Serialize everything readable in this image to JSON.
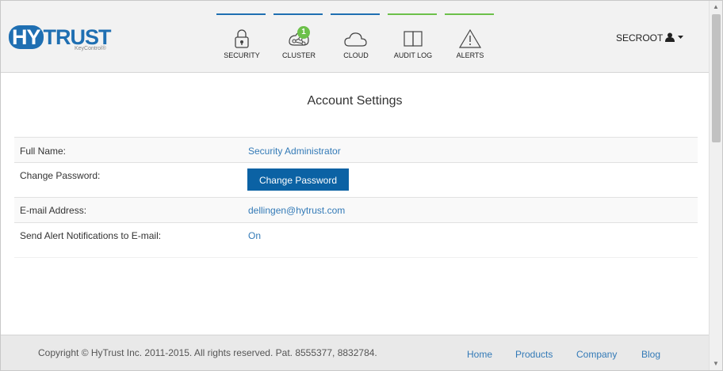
{
  "logo": {
    "hy": "HY",
    "trust": "TRUST",
    "sub": "KeyControl®"
  },
  "nav": {
    "items": [
      {
        "label": "SECURITY",
        "icon": "lock-icon",
        "bar_color": "#1f6fb2"
      },
      {
        "label": "CLUSTER",
        "icon": "cluster-icon",
        "bar_color": "#1f6fb2",
        "badge": "1"
      },
      {
        "label": "CLOUD",
        "icon": "cloud-icon",
        "bar_color": "#1f6fb2"
      },
      {
        "label": "AUDIT LOG",
        "icon": "book-icon",
        "bar_color": "#6cc04a"
      },
      {
        "label": "ALERTS",
        "icon": "warning-icon",
        "bar_color": "#6cc04a"
      }
    ]
  },
  "user": {
    "name": "SECROOT",
    "icon": "user-icon"
  },
  "page": {
    "title": "Account Settings"
  },
  "settings": {
    "full_name": {
      "label": "Full Name:",
      "value": "Security Administrator"
    },
    "password": {
      "label": "Change Password:",
      "button": "Change Password"
    },
    "email": {
      "label": "E-mail Address:",
      "value": "dellingen@hytrust.com"
    },
    "alerts": {
      "label": "Send Alert Notifications to E-mail:",
      "value": "On"
    }
  },
  "footer": {
    "copyright": "Copyright © HyTrust Inc. 2011-2015. All rights reserved. Pat. 8555377, 8832784.",
    "links": [
      "Home",
      "Products",
      "Company",
      "Blog"
    ]
  }
}
